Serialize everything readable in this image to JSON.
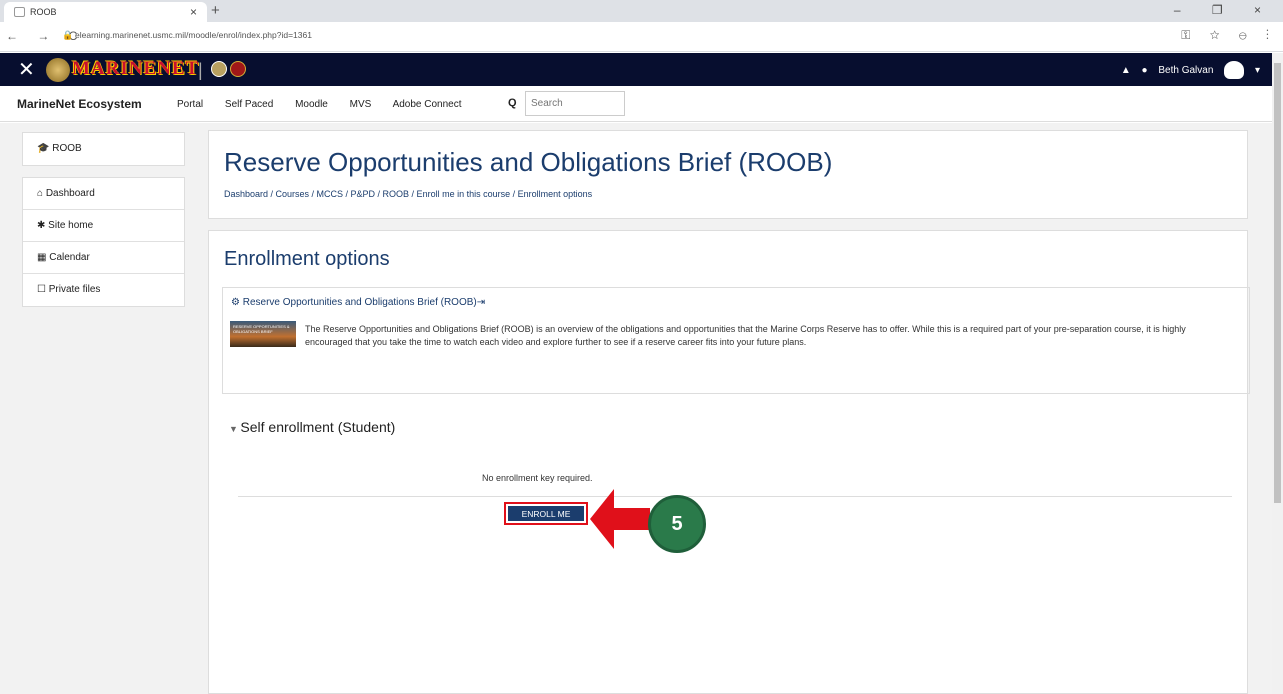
{
  "browser": {
    "tab_title": "ROOB",
    "tab_close": "×",
    "new_tab": "+",
    "window_controls": "– ❐ ×",
    "nav_buttons": "← → C",
    "url": "elearning.marinenet.usmc.mil/moodle/enrol/index.php?id=1361",
    "toolbar_icons": "⚿ ☆ ⊖ ⋮"
  },
  "topbar": {
    "close_glyph": "✕",
    "logo_text": "MARINENET",
    "user_name": "Beth Galvan",
    "bell": "🔔",
    "chat": "💬",
    "caret": "▾"
  },
  "ecosystem": {
    "brand": "MarineNet Ecosystem",
    "links": [
      "Portal",
      "Self Paced",
      "Moodle",
      "MVS",
      "Adobe Connect"
    ],
    "search_placeholder": "Search"
  },
  "sidebar": {
    "course_label": "ROOB",
    "items": [
      {
        "icon": "⌂",
        "label": "Dashboard"
      },
      {
        "icon": "✱",
        "label": "Site home"
      },
      {
        "icon": "▦",
        "label": "Calendar"
      },
      {
        "icon": "☐",
        "label": "Private files"
      }
    ]
  },
  "header": {
    "title": "Reserve Opportunities and Obligations Brief (ROOB)",
    "breadcrumb": "Dashboard / Courses / MCCS / P&PD / ROOB / Enroll me in this course / Enrollment options"
  },
  "main": {
    "heading": "Enrollment options",
    "course_title": "Reserve Opportunities and Obligations Brief (ROOB)",
    "thumb_text": "RESERVE OPPORTUNITIES & OBLIGATIONS BRIEF",
    "description": "The Reserve Opportunities and Obligations Brief (ROOB) is an overview of the obligations and opportunities that the Marine Corps Reserve has to offer. While this is a required part of your pre-separation course, it is highly encouraged that you take the time to watch each video and explore further to see if a reserve career fits into your future plans.",
    "self_enrollment": "Self enrollment (Student)",
    "no_key": "No enrollment key required.",
    "enroll_button": "ENROLL ME"
  },
  "annotation": {
    "step_number": "5",
    "arrow_color": "#e0101a",
    "badge_color": "#2a7a4a"
  }
}
